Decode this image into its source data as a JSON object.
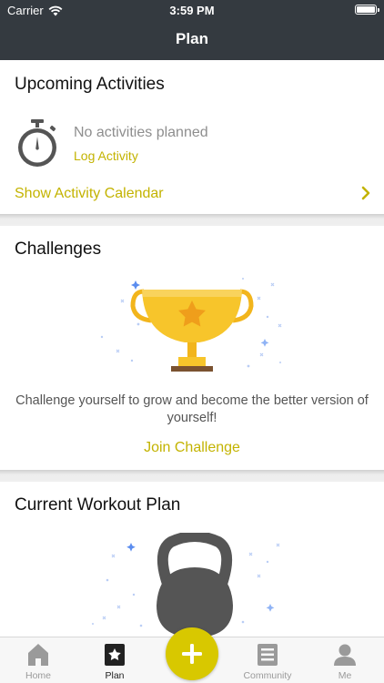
{
  "status_bar": {
    "carrier": "Carrier",
    "time": "3:59 PM"
  },
  "nav": {
    "title": "Plan"
  },
  "upcoming": {
    "title": "Upcoming Activities",
    "empty_text": "No activities planned",
    "log_link": "Log Activity",
    "calendar_link": "Show Activity Calendar",
    "icon": "stopwatch-icon"
  },
  "challenges": {
    "title": "Challenges",
    "description": "Challenge yourself to grow and become the better version of yourself!",
    "join_link": "Join Challenge",
    "icon": "trophy-icon"
  },
  "workout": {
    "title": "Current Workout Plan",
    "icon": "kettlebell-icon"
  },
  "tabbar": {
    "tabs": [
      {
        "label": "Home",
        "icon": "home-icon"
      },
      {
        "label": "Plan",
        "icon": "plan-icon",
        "active": true
      },
      {
        "label": "Community",
        "icon": "community-icon"
      },
      {
        "label": "Me",
        "icon": "profile-icon"
      }
    ],
    "fab_icon": "plus-icon"
  },
  "colors": {
    "accent": "#c3b300",
    "navbar": "#343a40",
    "fab": "#d8c800",
    "trophy": "#f7c52b"
  }
}
